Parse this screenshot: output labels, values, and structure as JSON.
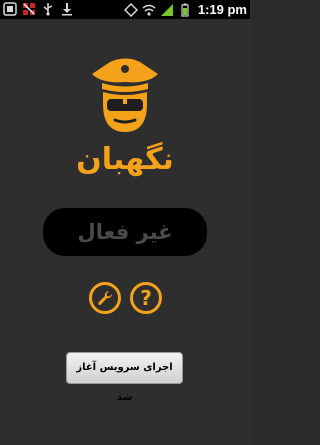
{
  "status_bar": {
    "time": "1:19 pm",
    "left_icons": [
      "notification-icon",
      "debug-icon",
      "usb-icon",
      "download-icon"
    ],
    "right_icons": [
      "sync-icon",
      "wifi-icon",
      "signal-icon",
      "battery-icon"
    ]
  },
  "app": {
    "title": "نگهبان",
    "accent_color": "#f5a21b",
    "logo_icon": "guard-icon"
  },
  "status": {
    "label": "غیر فعال"
  },
  "buttons": {
    "settings_icon": "wrench-icon",
    "help_label": "?",
    "start_label": "اجرای سرویس آغاز شد"
  }
}
